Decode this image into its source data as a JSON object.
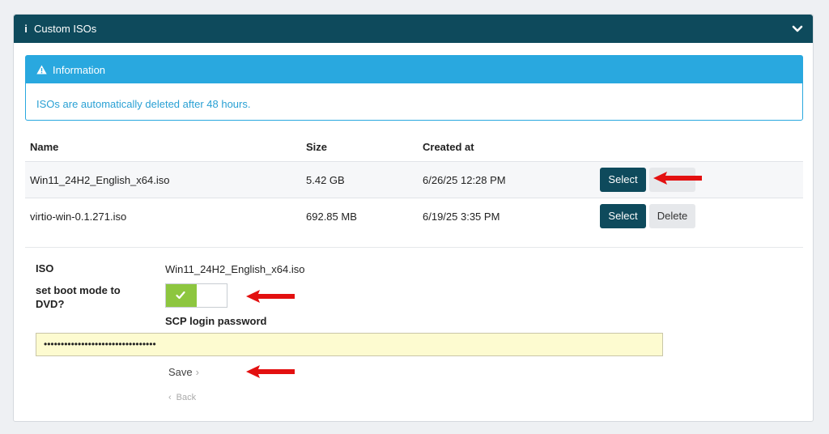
{
  "panel": {
    "title": "Custom ISOs",
    "info_icon": "i"
  },
  "alert": {
    "title": "Information",
    "message": "ISOs are automatically deleted after 48 hours."
  },
  "table": {
    "columns": [
      "Name",
      "Size",
      "Created at"
    ],
    "rows": [
      {
        "name": "Win11_24H2_English_x64.iso",
        "size": "5.42 GB",
        "created": "6/26/25 12:28 PM",
        "select": "Select",
        "delete": ""
      },
      {
        "name": "virtio-win-0.1.271.iso",
        "size": "692.85 MB",
        "created": "6/19/25 3:35 PM",
        "select": "Select",
        "delete": "Delete"
      }
    ]
  },
  "form": {
    "iso_label": "ISO",
    "iso_value": "Win11_24H2_English_x64.iso",
    "boot_label_line1": "set boot mode to",
    "boot_label_line2": "DVD?",
    "boot_enabled": true,
    "scp_label": "SCP login password",
    "password_value": "•••••••••••••••••••••••••••••••••",
    "save_label": "Save",
    "back_label": "Back"
  },
  "colors": {
    "header": "#0e4a5c",
    "info": "#29a8df",
    "toggle_on": "#8dc63f",
    "arrow": "#e31010"
  }
}
